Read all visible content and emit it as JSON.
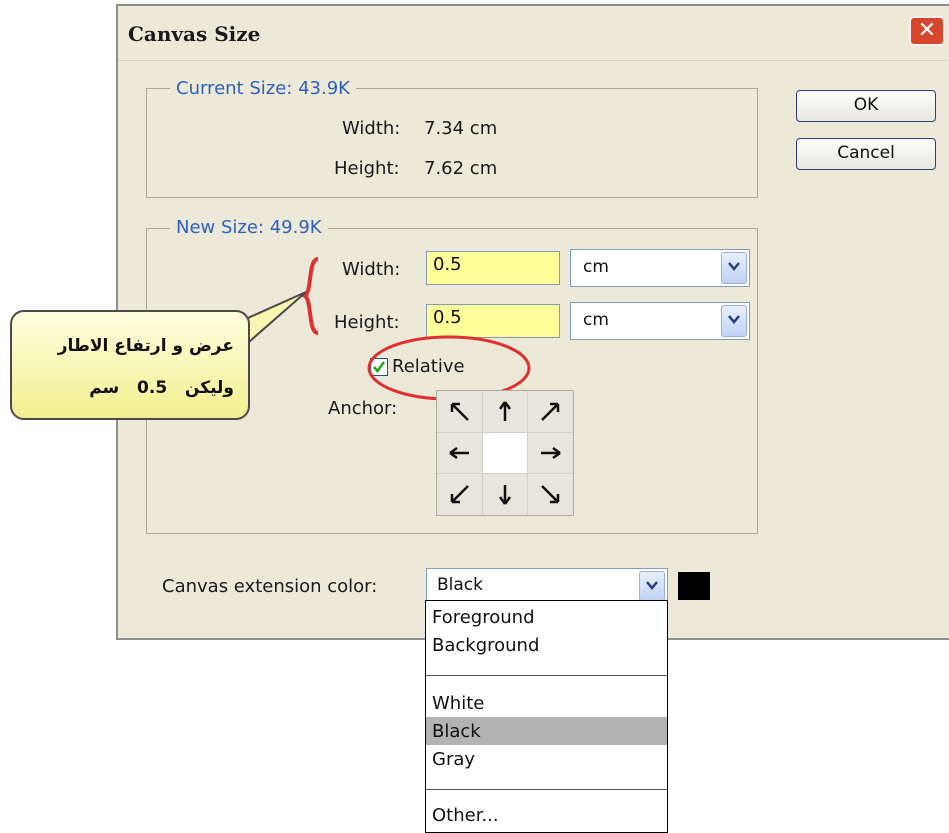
{
  "dialog": {
    "title": "Canvas Size",
    "close_glyph": "✕"
  },
  "current_size": {
    "legend": "Current Size: 43.9K",
    "width_label": "Width:",
    "width_value": "7.34 cm",
    "height_label": "Height:",
    "height_value": "7.62 cm"
  },
  "new_size": {
    "legend": "New Size: 49.9K",
    "width_label": "Width:",
    "width_value": "0.5",
    "width_unit": "cm",
    "height_label": "Height:",
    "height_value": "0.5",
    "height_unit": "cm",
    "relative_label": "Relative",
    "relative_checked": true,
    "anchor_label": "Anchor:"
  },
  "buttons": {
    "ok": "OK",
    "cancel": "Cancel"
  },
  "extension": {
    "label": "Canvas extension color:",
    "selected": "Black",
    "swatch_color": "#000000",
    "options": [
      "Foreground",
      "Background",
      "White",
      "Black",
      "Gray",
      "Other..."
    ]
  },
  "annotation": {
    "line1": "عرض و ارتفاع الاطار",
    "line2": "وليكن   0.5   سم",
    "highlight_color": "#e03030"
  },
  "colors": {
    "legend_blue": "#2f5fbf",
    "field_yellow": "#ffff99"
  }
}
